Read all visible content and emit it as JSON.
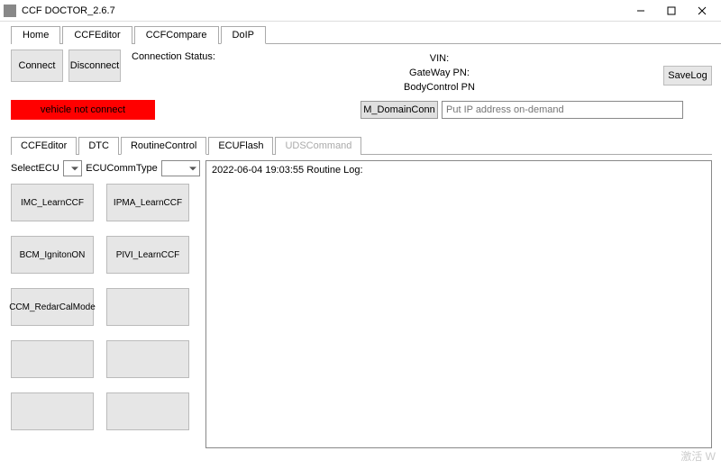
{
  "window": {
    "title": "CCF DOCTOR_2.6.7"
  },
  "outer_tabs": {
    "items": [
      "Home",
      "CCFEditor",
      "CCFCompare",
      "DoIP"
    ],
    "active_index": 3
  },
  "doip": {
    "connect_label": "Connect",
    "disconnect_label": "Disconnect",
    "connection_status_label": "Connection Status:",
    "connection_status_value": "",
    "warning_text": "vehicle not connect",
    "vin_label": "VIN:",
    "vin_value": "",
    "gateway_label": "GateWay PN:",
    "gateway_value": "",
    "bodycontrol_label": "BodyControl PN",
    "bodycontrol_value": "",
    "savelog_label": "SaveLog",
    "domain_btn_label": "M_DomainConn",
    "domain_input_placeholder": "Put IP address on-demand",
    "domain_input_value": ""
  },
  "inner_tabs": {
    "items": [
      "CCFEditor",
      "DTC",
      "RoutineControl",
      "ECUFlash",
      "UDSCommand"
    ],
    "active_index": 2,
    "disabled_indices": [
      4
    ]
  },
  "routine": {
    "select_ecu_label": "SelectECU",
    "select_ecu_value": "",
    "ecu_comm_label": "ECUCommType",
    "ecu_comm_value": "",
    "buttons": [
      "IMC_LearnCCF",
      "IPMA_LearnCCF",
      "BCM_IgnitonON",
      "PIVI_LearnCCF",
      "CCM_RedarCalMode",
      "",
      "",
      "",
      "",
      ""
    ],
    "log_header": "2022-06-04 19:03:55   Routine Log:"
  },
  "watermark": "激活 W"
}
